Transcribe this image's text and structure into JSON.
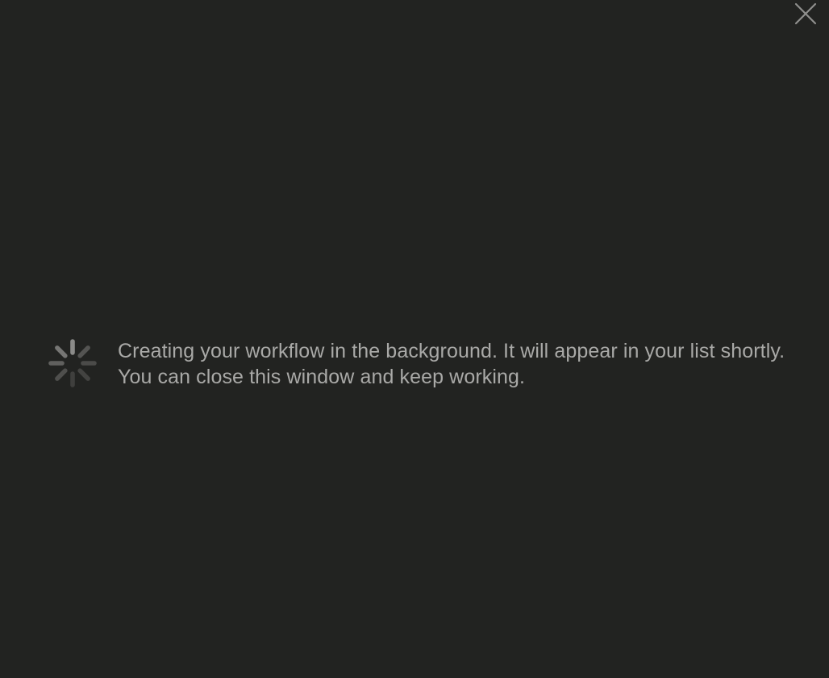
{
  "dialog": {
    "message": "Creating your workflow in the background. It will appear in your list shortly. You can close this window and keep working."
  },
  "icons": {
    "close": "close-icon",
    "loading": "loading-spinner-icon"
  },
  "colors": {
    "background": "#222321",
    "text": "#a9a9a7",
    "close_icon": "#8f8f8d",
    "spinner": "#6c6c6a"
  }
}
